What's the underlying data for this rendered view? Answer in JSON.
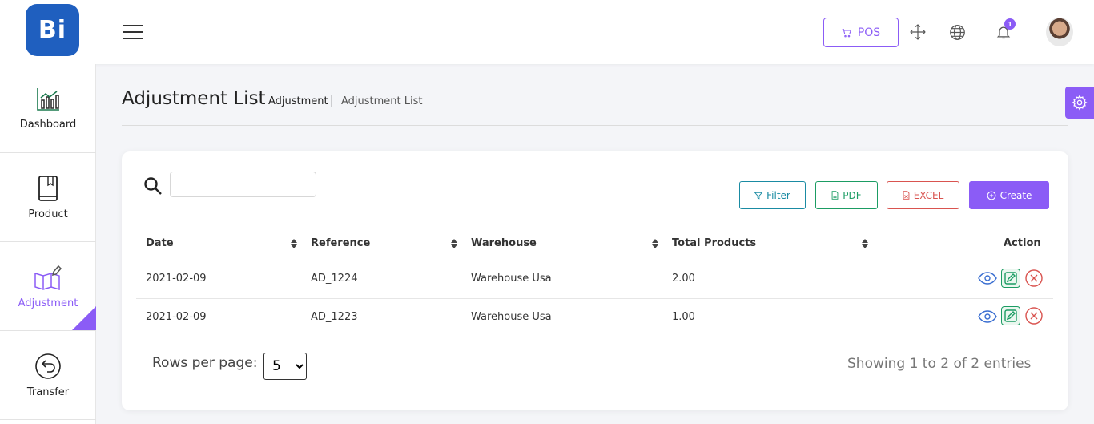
{
  "app": {
    "logo_text": "Bi",
    "brand_color": "#8b5cf6"
  },
  "topbar": {
    "pos_label": "POS",
    "notification_count": "1"
  },
  "sidebar": {
    "items": [
      {
        "label": "Dashboard",
        "icon": "chart-icon"
      },
      {
        "label": "Product",
        "icon": "book-icon"
      },
      {
        "label": "Adjustment",
        "icon": "map-edit-icon",
        "active": true
      },
      {
        "label": "Transfer",
        "icon": "arrow-circle-icon"
      }
    ]
  },
  "header": {
    "title": "Adjustment List",
    "breadcrumb": [
      "Adjustment",
      "|",
      "Adjustment List"
    ]
  },
  "toolbar": {
    "search_placeholder": "",
    "filter_label": "Filter",
    "pdf_label": "PDF",
    "excel_label": "EXCEL",
    "create_label": "Create"
  },
  "table": {
    "columns": [
      "Date",
      "Reference",
      "Warehouse",
      "Total Products",
      "Action"
    ],
    "rows": [
      {
        "date": "2021-02-09",
        "reference": "AD_1224",
        "warehouse": "Warehouse Usa",
        "total": "2.00"
      },
      {
        "date": "2021-02-09",
        "reference": "AD_1223",
        "warehouse": "Warehouse Usa",
        "total": "1.00"
      }
    ]
  },
  "footer": {
    "rows_per_page_label": "Rows per page:",
    "rows_per_page_value": "5",
    "showing_text": "Showing 1 to 2 of 2 entries"
  }
}
